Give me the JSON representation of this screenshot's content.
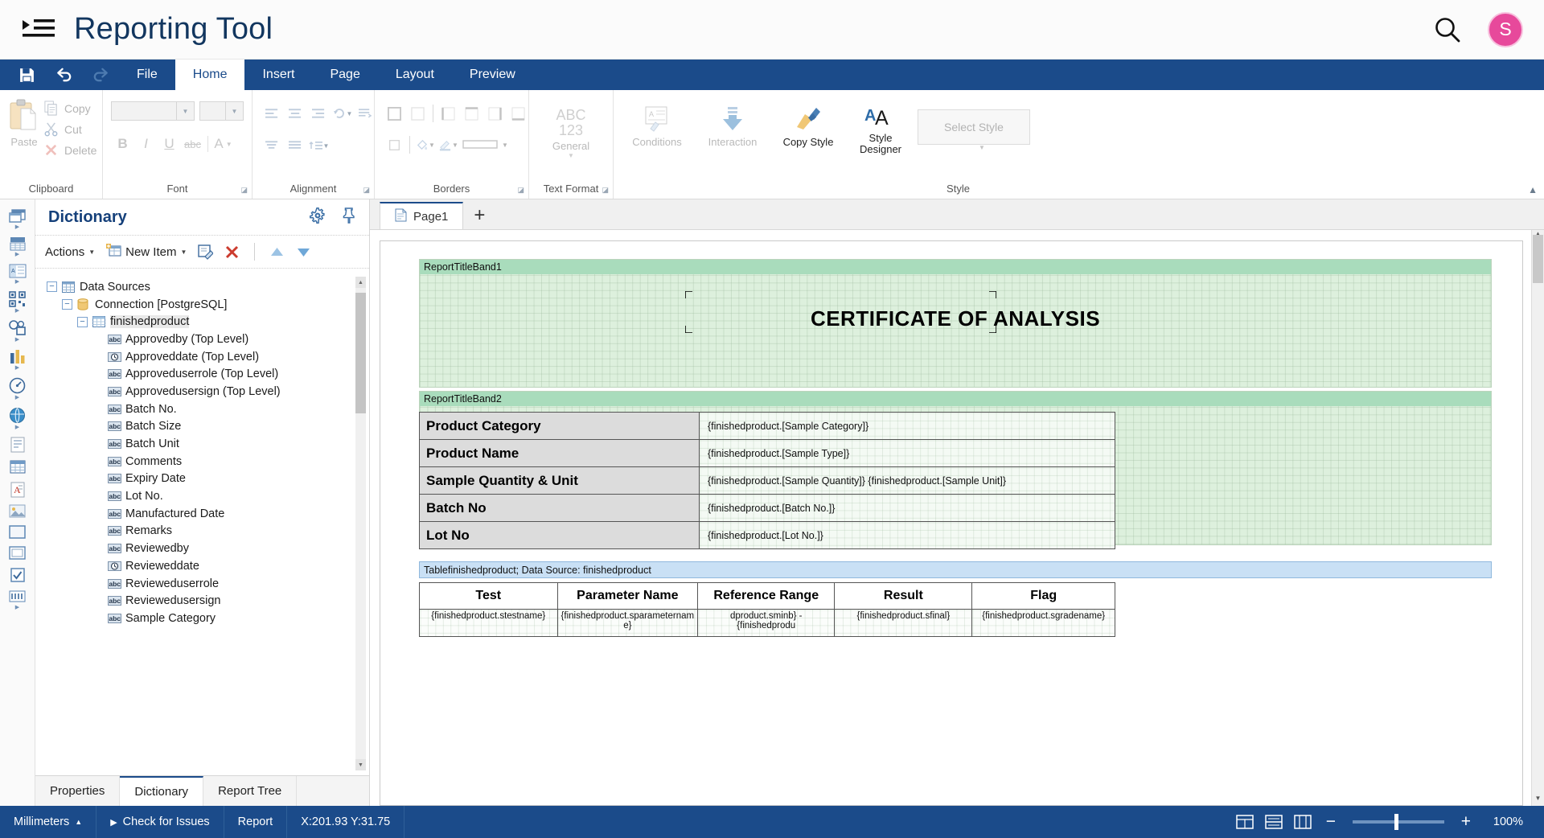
{
  "app": {
    "title": "Reporting Tool",
    "menu_icon": "hamburger-icon",
    "search_icon": "search-icon",
    "avatar_initial": "S",
    "accent_color": "#1b4b8a",
    "avatar_color": "#e7499b"
  },
  "quick_access": [
    {
      "name": "save",
      "icon": "save-icon"
    },
    {
      "name": "undo",
      "icon": "undo-icon"
    },
    {
      "name": "redo",
      "icon": "redo-icon"
    }
  ],
  "ribbon": {
    "tabs": [
      {
        "label": "File",
        "active": false
      },
      {
        "label": "Home",
        "active": true
      },
      {
        "label": "Insert",
        "active": false
      },
      {
        "label": "Page",
        "active": false
      },
      {
        "label": "Layout",
        "active": false
      },
      {
        "label": "Preview",
        "active": false
      }
    ],
    "groups": [
      {
        "label": "Clipboard",
        "paste_label": "Paste",
        "items": [
          {
            "label": "Copy",
            "icon": "copy-icon"
          },
          {
            "label": "Cut",
            "icon": "cut-icon"
          },
          {
            "label": "Delete",
            "icon": "delete-icon"
          }
        ]
      },
      {
        "label": "Font",
        "font_name_value": "",
        "font_size_value": "",
        "buttons": [
          "B",
          "I",
          "U",
          "abc",
          "A"
        ]
      },
      {
        "label": "Alignment"
      },
      {
        "label": "Borders"
      },
      {
        "label": "Text Format",
        "format_icon_top": "ABC",
        "format_icon_bottom": "123",
        "format_label": "General"
      },
      {
        "label": "Style",
        "conditions_label": "Conditions",
        "interaction_label": "Interaction",
        "copy_style_label": "Copy Style",
        "style_designer_label": "Style Designer",
        "select_style_label": "Select Style"
      }
    ]
  },
  "rail": [
    {
      "name": "pages-icon"
    },
    {
      "name": "bands-icon"
    },
    {
      "name": "cross-bands-icon"
    },
    {
      "name": "barcode-icon"
    },
    {
      "name": "shapes-icon"
    },
    {
      "name": "chart-icon"
    },
    {
      "name": "gauge-icon"
    },
    {
      "name": "map-icon"
    },
    {
      "name": "text-icon"
    },
    {
      "name": "table-icon"
    },
    {
      "name": "rich-text-icon"
    },
    {
      "name": "image-icon"
    },
    {
      "name": "panel-icon"
    },
    {
      "name": "subreport-icon"
    },
    {
      "name": "checkbox-icon"
    },
    {
      "name": "zip-code-icon"
    }
  ],
  "dictionary": {
    "title": "Dictionary",
    "gear_icon": "gear-icon",
    "pin_icon": "pin-icon",
    "toolbar": {
      "actions_label": "Actions",
      "new_item_label": "New Item",
      "edit_icon": "edit-icon",
      "delete_icon": "delete-x-icon",
      "move_up_icon": "move-up-icon",
      "move_down_icon": "move-down-icon"
    },
    "tree": [
      {
        "label": "Data Sources",
        "depth": 0,
        "expander": "minus",
        "icon": "datasources-icon"
      },
      {
        "label": "Connection [PostgreSQL]",
        "depth": 1,
        "expander": "minus",
        "icon": "connection-icon"
      },
      {
        "label": "finishedproduct",
        "depth": 2,
        "expander": "minus",
        "icon": "table-icon",
        "selected": true
      },
      {
        "label": "Approvedby (Top Level)",
        "depth": 3,
        "icon": "abc-icon"
      },
      {
        "label": "Approveddate (Top Level)",
        "depth": 3,
        "icon": "datetime-icon"
      },
      {
        "label": "Approveduserrole (Top Level)",
        "depth": 3,
        "icon": "abc-icon"
      },
      {
        "label": "Approvedusersign (Top Level)",
        "depth": 3,
        "icon": "abc-icon"
      },
      {
        "label": "Batch No.",
        "depth": 3,
        "icon": "abc-icon"
      },
      {
        "label": "Batch Size",
        "depth": 3,
        "icon": "abc-icon"
      },
      {
        "label": "Batch Unit",
        "depth": 3,
        "icon": "abc-icon"
      },
      {
        "label": "Comments",
        "depth": 3,
        "icon": "abc-icon"
      },
      {
        "label": "Expiry Date",
        "depth": 3,
        "icon": "abc-icon"
      },
      {
        "label": "Lot No.",
        "depth": 3,
        "icon": "abc-icon"
      },
      {
        "label": "Manufactured Date",
        "depth": 3,
        "icon": "abc-icon"
      },
      {
        "label": "Remarks",
        "depth": 3,
        "icon": "abc-icon"
      },
      {
        "label": "Reviewedby",
        "depth": 3,
        "icon": "abc-icon"
      },
      {
        "label": "Revieweddate",
        "depth": 3,
        "icon": "datetime-icon"
      },
      {
        "label": "Revieweduserrole",
        "depth": 3,
        "icon": "abc-icon"
      },
      {
        "label": "Reviewedusersign",
        "depth": 3,
        "icon": "abc-icon"
      },
      {
        "label": "Sample Category",
        "depth": 3,
        "icon": "abc-icon"
      }
    ],
    "tabs": [
      {
        "label": "Properties",
        "active": false
      },
      {
        "label": "Dictionary",
        "active": true
      },
      {
        "label": "Report Tree",
        "active": false
      }
    ]
  },
  "canvas": {
    "page_tab_label": "Page1",
    "page_tab_icon": "page-icon",
    "add_page_label": "+",
    "bands": [
      {
        "name": "ReportTitleBand1"
      },
      {
        "name": "ReportTitleBand2"
      }
    ],
    "report_title": "CERTIFICATE OF ANALYSIS",
    "info_band_label": "Tablefinishedproduct; Data Source: finishedproduct",
    "kv_rows": [
      {
        "key": "Product Category",
        "value": "{finishedproduct.[Sample Category]}"
      },
      {
        "key": "Product Name",
        "value": "{finishedproduct.[Sample Type]}"
      },
      {
        "key": "Sample Quantity & Unit",
        "value": "{finishedproduct.[Sample Quantity]} {finishedproduct.[Sample Unit]}"
      },
      {
        "key": "Batch No",
        "value": "{finishedproduct.[Batch No.]}"
      },
      {
        "key": "Lot No",
        "value": "{finishedproduct.[Lot No.]}"
      }
    ],
    "data_table": {
      "headers": [
        "Test",
        "Parameter Name",
        "Reference Range",
        "Result",
        "Flag"
      ],
      "row": [
        "{finishedproduct.stestname}",
        "{finishedproduct.sparameternam\ne}",
        "dproduct.sminb} - {finishedprodu",
        "{finishedproduct.sfinal}",
        "{finishedproduct.sgradename}"
      ]
    }
  },
  "status_bar": {
    "units_label": "Millimeters",
    "units_caret": "▲",
    "check_issues_label": "Check for Issues",
    "check_issues_icon": "play-icon",
    "report_label": "Report",
    "coordinates": "X:201.93 Y:31.75",
    "view_buttons": [
      {
        "name": "single-page-view-icon"
      },
      {
        "name": "continuous-view-icon"
      },
      {
        "name": "multi-page-view-icon"
      }
    ],
    "zoom_out": "−",
    "zoom_in": "+",
    "zoom_value": "100%"
  }
}
